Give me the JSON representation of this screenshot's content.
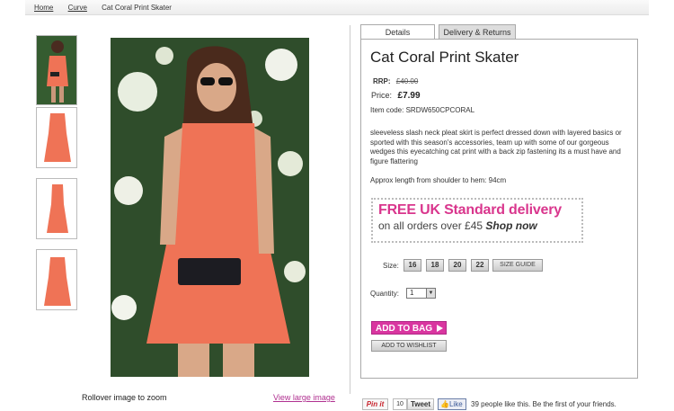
{
  "breadcrumb": {
    "items": [
      "Home",
      "Curve"
    ],
    "current": "Cat Coral Print Skater"
  },
  "gallery": {
    "zoom_hint": "Rollover image to zoom",
    "large_link": "View large image"
  },
  "tabs": {
    "details": "Details",
    "delivery": "Delivery & Returns"
  },
  "product": {
    "title": "Cat Coral Print Skater",
    "rrp_label": "RRP:",
    "rrp_value": "£40.00",
    "price_label": "Price:",
    "price_value": "£7.99",
    "item_code": "Item code: SRDW650CPCORAL",
    "description": "sleeveless slash neck pleat skirt is perfect dressed down with layered basics or sported with this season's accessories, team up with some of our gorgeous wedges this eyecatching cat print with a back zip fastening its a must have and figure flattering",
    "approx_length": "Approx length from shoulder to hem: 94cm"
  },
  "banner": {
    "line1": "FREE UK Standard delivery",
    "line2": "on all orders over £45",
    "line2_emph": "Shop now"
  },
  "sizes": {
    "label": "Size:",
    "options": [
      "16",
      "18",
      "20",
      "22"
    ],
    "guide": "SIZE GUIDE"
  },
  "quantity": {
    "label": "Quantity:",
    "value": "1"
  },
  "actions": {
    "add_to_bag": "ADD TO BAG",
    "add_to_wishlist": "ADD TO WISHLIST"
  },
  "social": {
    "pin": "Pin it",
    "tweet_count": "10",
    "tweet": "Tweet",
    "like": "Like",
    "like_text": "39 people like this. Be the first of your friends."
  },
  "colors": {
    "accent_pink": "#d936a0",
    "dress_coral": "#ef7356"
  }
}
